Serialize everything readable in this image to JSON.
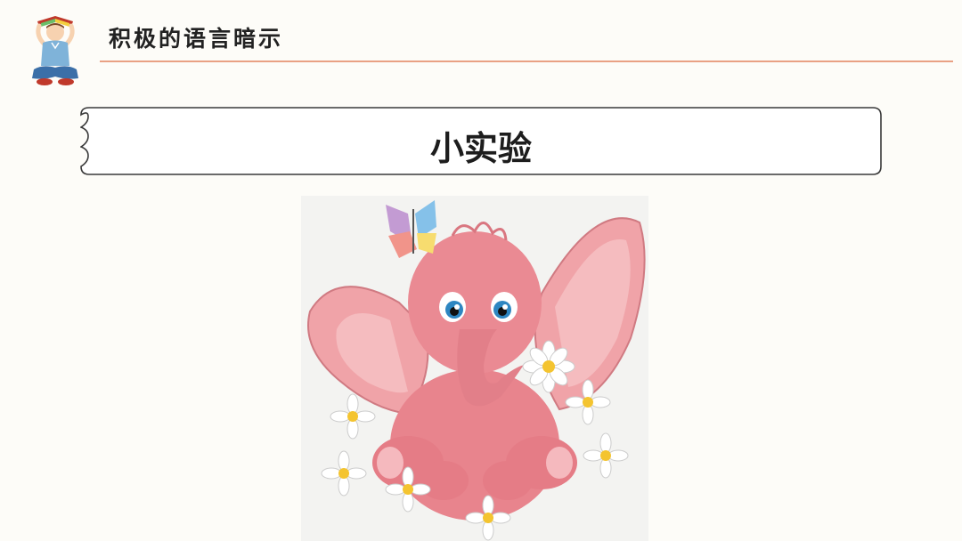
{
  "header": {
    "title": "积极的语言暗示"
  },
  "banner": {
    "title": "小实验"
  },
  "colors": {
    "accent_rule": "#e9a184",
    "background": "#fdfcf8",
    "elephant_pink": "#e8848d"
  },
  "icons": {
    "logo": "boy-reading-book-icon",
    "illustration": "pink-elephant-with-daisies"
  }
}
